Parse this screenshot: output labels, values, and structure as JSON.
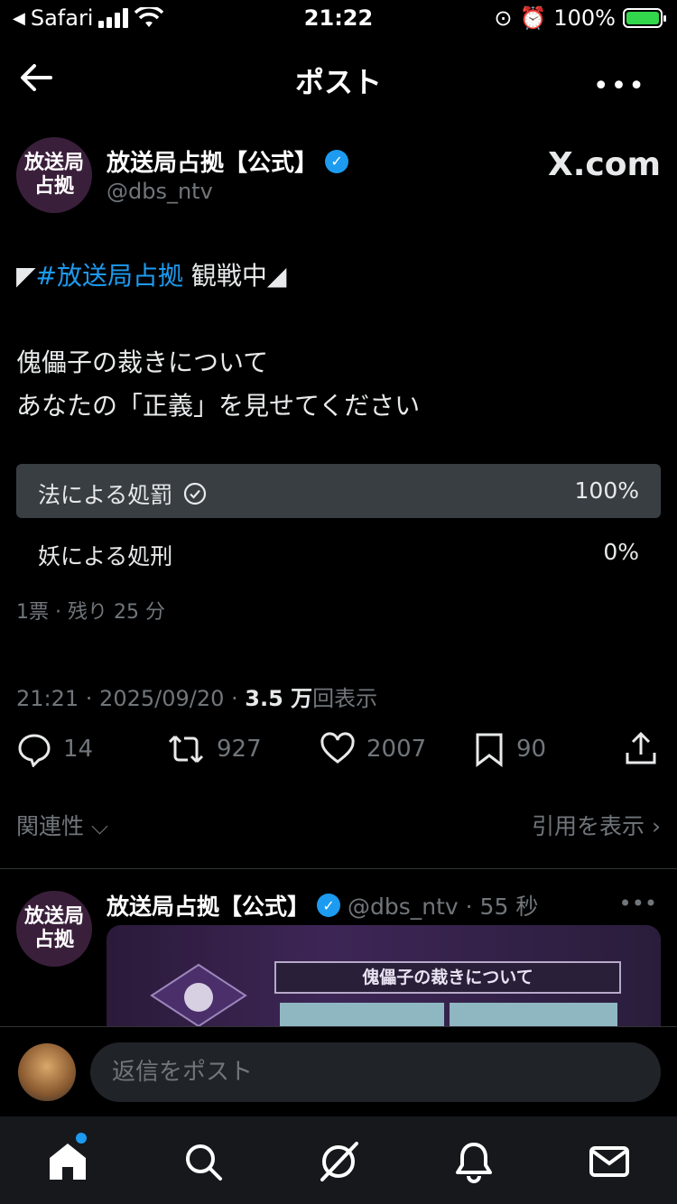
{
  "status_bar": {
    "back_app": "Safari",
    "time": "21:22",
    "battery": "100%"
  },
  "header": {
    "title": "ポスト"
  },
  "author": {
    "avatar_text": "放送局\n占拠",
    "name": "放送局占拠【公式】",
    "handle": "@dbs_ntv",
    "watermark": "X.com"
  },
  "tweet": {
    "line1_prefix": "◤",
    "hashtag": "#放送局占拠",
    "line1_suffix": " 観戦中◢",
    "line2": "傀儡子の裁きについて",
    "line3": "あなたの「正義」を見せてください"
  },
  "poll": {
    "options": [
      {
        "label": "法による処罰",
        "percent_text": "100%",
        "percent": 100,
        "selected": true
      },
      {
        "label": "妖による処刑",
        "percent_text": "0%",
        "percent": 0,
        "selected": false
      }
    ],
    "meta": "1票 · 残り 25 分"
  },
  "timestamp": {
    "time_date": "21:21 · 2025/09/20 · ",
    "views": "3.5 万",
    "views_suffix": "回表示"
  },
  "actions": {
    "replies": "14",
    "reposts": "927",
    "likes": "2007",
    "bookmarks": "90"
  },
  "meta_row": {
    "relevance": "関連性",
    "quotes": "引用を表示"
  },
  "reply_post": {
    "name": "放送局占拠【公式】",
    "handle": "@dbs_ntv · 55 秒",
    "avatar_text": "放送局\n占拠",
    "media_text": "傀儡子の裁きについて"
  },
  "compose": {
    "placeholder": "返信をポスト"
  },
  "colors": {
    "accent": "#1d9bf0",
    "muted": "#71767b",
    "poll_bar": "#393e43"
  }
}
